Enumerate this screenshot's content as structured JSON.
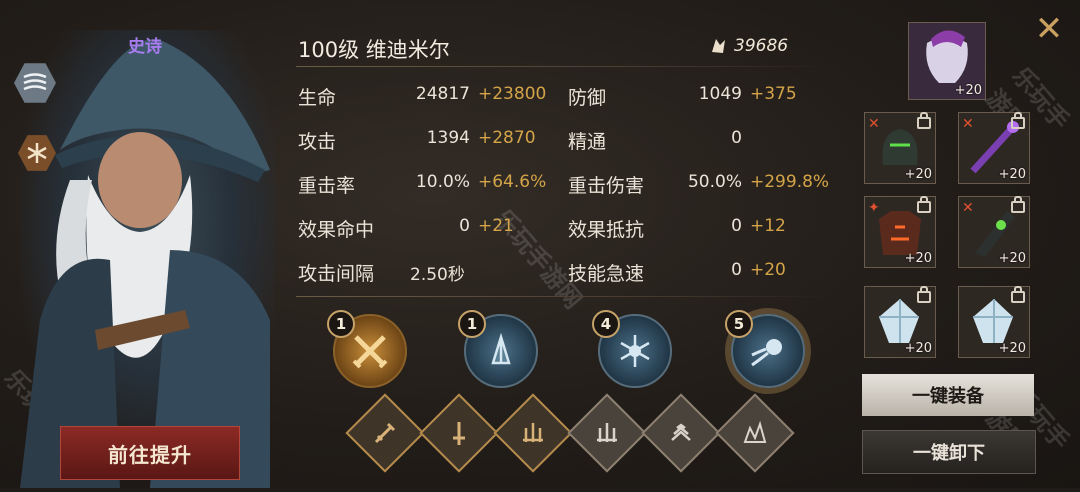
{
  "hero": {
    "rarity": "史诗",
    "name": "100级 维迪米尔",
    "power": "39686",
    "upgrade_button": "前往提升"
  },
  "stats": [
    {
      "label": "生命",
      "base": "24817",
      "bonus": "+23800"
    },
    {
      "label": "防御",
      "base": "1049",
      "bonus": "+375"
    },
    {
      "label": "攻击",
      "base": "1394",
      "bonus": "+2870"
    },
    {
      "label": "精通",
      "base": "0",
      "bonus": ""
    },
    {
      "label": "重击率",
      "base": "10.0%",
      "bonus": "+64.6%"
    },
    {
      "label": "重击伤害",
      "base": "50.0%",
      "bonus": "+299.8%"
    },
    {
      "label": "效果命中",
      "base": "0",
      "bonus": "+21"
    },
    {
      "label": "效果抵抗",
      "base": "0",
      "bonus": "+12"
    },
    {
      "label": "攻击间隔",
      "base": "2.50秒",
      "bonus": ""
    },
    {
      "label": "技能急速",
      "base": "0",
      "bonus": "+20"
    }
  ],
  "skills": [
    {
      "level": "1",
      "icon": "crossed-swords-icon"
    },
    {
      "level": "1",
      "icon": "ice-shard-icon"
    },
    {
      "level": "4",
      "icon": "frost-burst-icon"
    },
    {
      "level": "5",
      "icon": "comet-icon"
    }
  ],
  "runes": [
    "sword-icon",
    "dagger-icon",
    "triple-blade-icon",
    "claw-icon",
    "wave-icon",
    "spikes-icon"
  ],
  "equipment": {
    "mask": "+20",
    "slots": [
      "+20",
      "+20",
      "+20",
      "+20",
      "+20",
      "+20"
    ]
  },
  "actions": {
    "equip_all": "一键装备",
    "unequip_all": "一键卸下"
  },
  "watermark": "乐玩手游网"
}
